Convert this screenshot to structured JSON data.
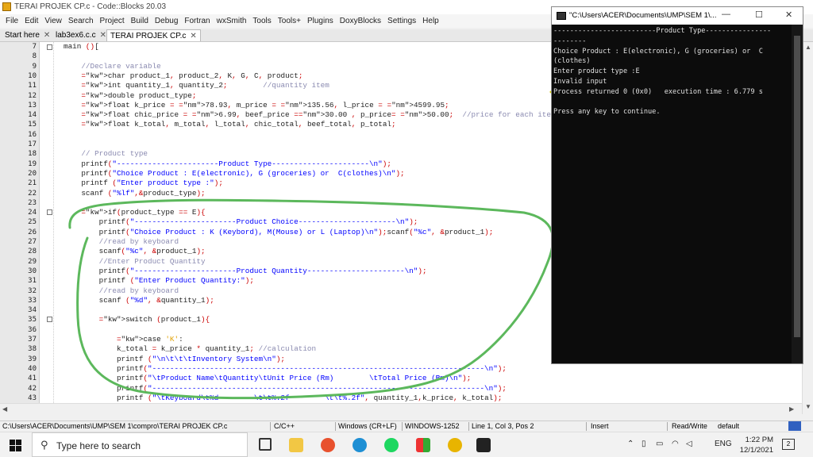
{
  "window": {
    "title": "TERAI PROJEK CP.c - Code::Blocks 20.03"
  },
  "menu": [
    "File",
    "Edit",
    "View",
    "Search",
    "Project",
    "Build",
    "Debug",
    "Fortran",
    "wxSmith",
    "Tools",
    "Tools+",
    "Plugins",
    "DoxyBlocks",
    "Settings",
    "Help"
  ],
  "tabs": [
    {
      "label": "Start here",
      "close": "✕"
    },
    {
      "label": "lab3ex6.c.c",
      "close": "✕"
    },
    {
      "label": "TERAI PROJEK CP.c",
      "close": "✕"
    }
  ],
  "editor": {
    "line_numbers": [
      "7",
      "8",
      "9",
      "10",
      "11",
      "12",
      "13",
      "14",
      "15",
      "16",
      "17",
      "18",
      "19",
      "20",
      "21",
      "22",
      "23",
      "24",
      "25",
      "26",
      "27",
      "28",
      "29",
      "30",
      "31",
      "32",
      "33",
      "34",
      "35",
      "36",
      "37",
      "38",
      "39",
      "40",
      "41",
      "42",
      "43"
    ],
    "lines": [
      "main ()[",
      "",
      "    //Declare variable",
      "    char product_1, product_2, K, G, C, product;",
      "    int quantity_1, quantity_2;        //quantity item",
      "    double product_type;",
      "    float k_price = 78.93, m_price = 135.56, l_price = 4599.95;",
      "    float chic_price = 6.99, beef_price =30.00 , p_price= 50.00;  //price for each item",
      "    float k_total, m_total, l_total, chic_total, beef_total, p_total;",
      "",
      "",
      "    // Product type",
      "    printf(\"-----------------------Product Type----------------------\\n\");",
      "    printf(\"Choice Product : E(electronic), G (groceries) or  C(clothes)\\n\");",
      "    printf (\"Enter product type :\");",
      "    scanf (\"%lf\",&product_type);",
      "",
      "    if(product_type == E){",
      "        printf(\"-----------------------Product Choice----------------------\\n\");",
      "        printf(\"Choice Product : K (Keybord), M(Mouse) or L (Laptop)\\n\");scanf(\"%c\", &product_1);",
      "        //read by keyboard",
      "        scanf(\"%c\", &product_1);",
      "        //Enter Product Quantity",
      "        printf(\"-----------------------Product Quantity----------------------\\n\");",
      "        printf (\"Enter Product Quantity:\");",
      "        //read by keyboard",
      "        scanf (\"%d\", &quantity_1);",
      "",
      "        switch (product_1){",
      "",
      "            case 'K':",
      "            k_total = k_price * quantity_1; //calculation",
      "            printf (\"\\n\\t\\t\\tInventory System\\n\");",
      "            printf(\"---------------------------------------------------------------------------\\n\");",
      "            printf(\"\\tProduct Name\\tQuantity\\tUnit Price (Rm)        \\tTotal Price (Rm)\\n\");",
      "            printf(\"---------------------------------------------------------------------------\\n\");",
      "            printf (\"\\tKeyboard\\t%d        \\t\\t%.2f        \\t\\t%.2f\", quantity_1,k_price, k_total);"
    ]
  },
  "status": {
    "path": "C:\\Users\\ACER\\Documents\\UMP\\SEM 1\\compro\\TERAI PROJEK CP.c",
    "lang": "C/C++",
    "eol": "Windows (CR+LF)",
    "encoding": "WINDOWS-1252",
    "position": "Line 1, Col 3, Pos 2",
    "mode": "Insert",
    "access": "Read/Write",
    "profile": "default"
  },
  "console": {
    "title": "\"C:\\Users\\ACER\\Documents\\UMP\\SEM 1\\...",
    "min": "—",
    "max": "☐",
    "close": "✕",
    "lines": [
      "-------------------------Product Type----------------",
      "--------",
      "Choice Product : E(electronic), G (groceries) or  C",
      "(clothes)",
      "Enter product type :E",
      "Invalid input",
      "Process returned 0 (0x0)   execution time : 6.779 s",
      "",
      "Press any key to continue."
    ]
  },
  "taskbar": {
    "search_placeholder": "Type here to search",
    "lang": "ENG",
    "time": "1:22 PM",
    "date": "12/1/2021",
    "notif_count": "2"
  },
  "colors": {
    "annotation_green": "#5cb85c",
    "annotation_yellow": "#d4c800"
  }
}
